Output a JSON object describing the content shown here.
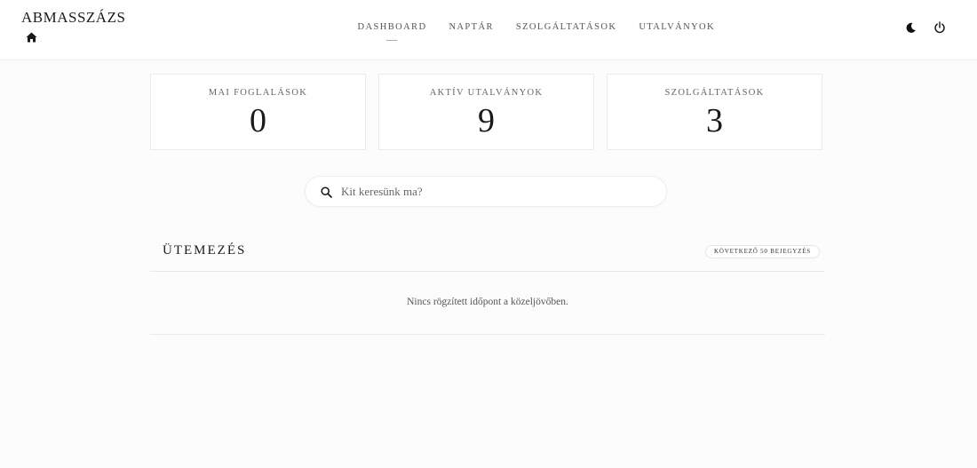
{
  "header": {
    "brand": "ABMASSZÁZS",
    "home_icon": "home-icon",
    "nav": [
      {
        "label": "DASHBOARD",
        "active": true
      },
      {
        "label": "NAPTÁR",
        "active": false
      },
      {
        "label": "SZOLGÁLTATÁSOK",
        "active": false
      },
      {
        "label": "UTALVÁNYOK",
        "active": false
      }
    ],
    "theme_icon": "moon-icon",
    "logout_icon": "power-icon",
    "accent_color": "#c9b26b"
  },
  "stats": [
    {
      "label": "MAI FOGLALÁSOK",
      "value": "0"
    },
    {
      "label": "AKTÍV UTALVÁNYOK",
      "value": "9"
    },
    {
      "label": "SZOLGÁLTATÁSOK",
      "value": "3"
    }
  ],
  "search": {
    "placeholder": "Kit keresünk ma?",
    "value": ""
  },
  "schedule": {
    "title": "ÜTEMEZÉS",
    "badge": "KÖVETKEZŐ 50 BEJEGYZÉS",
    "empty_message": "Nincs rögzített időpont a közeljövőben."
  }
}
